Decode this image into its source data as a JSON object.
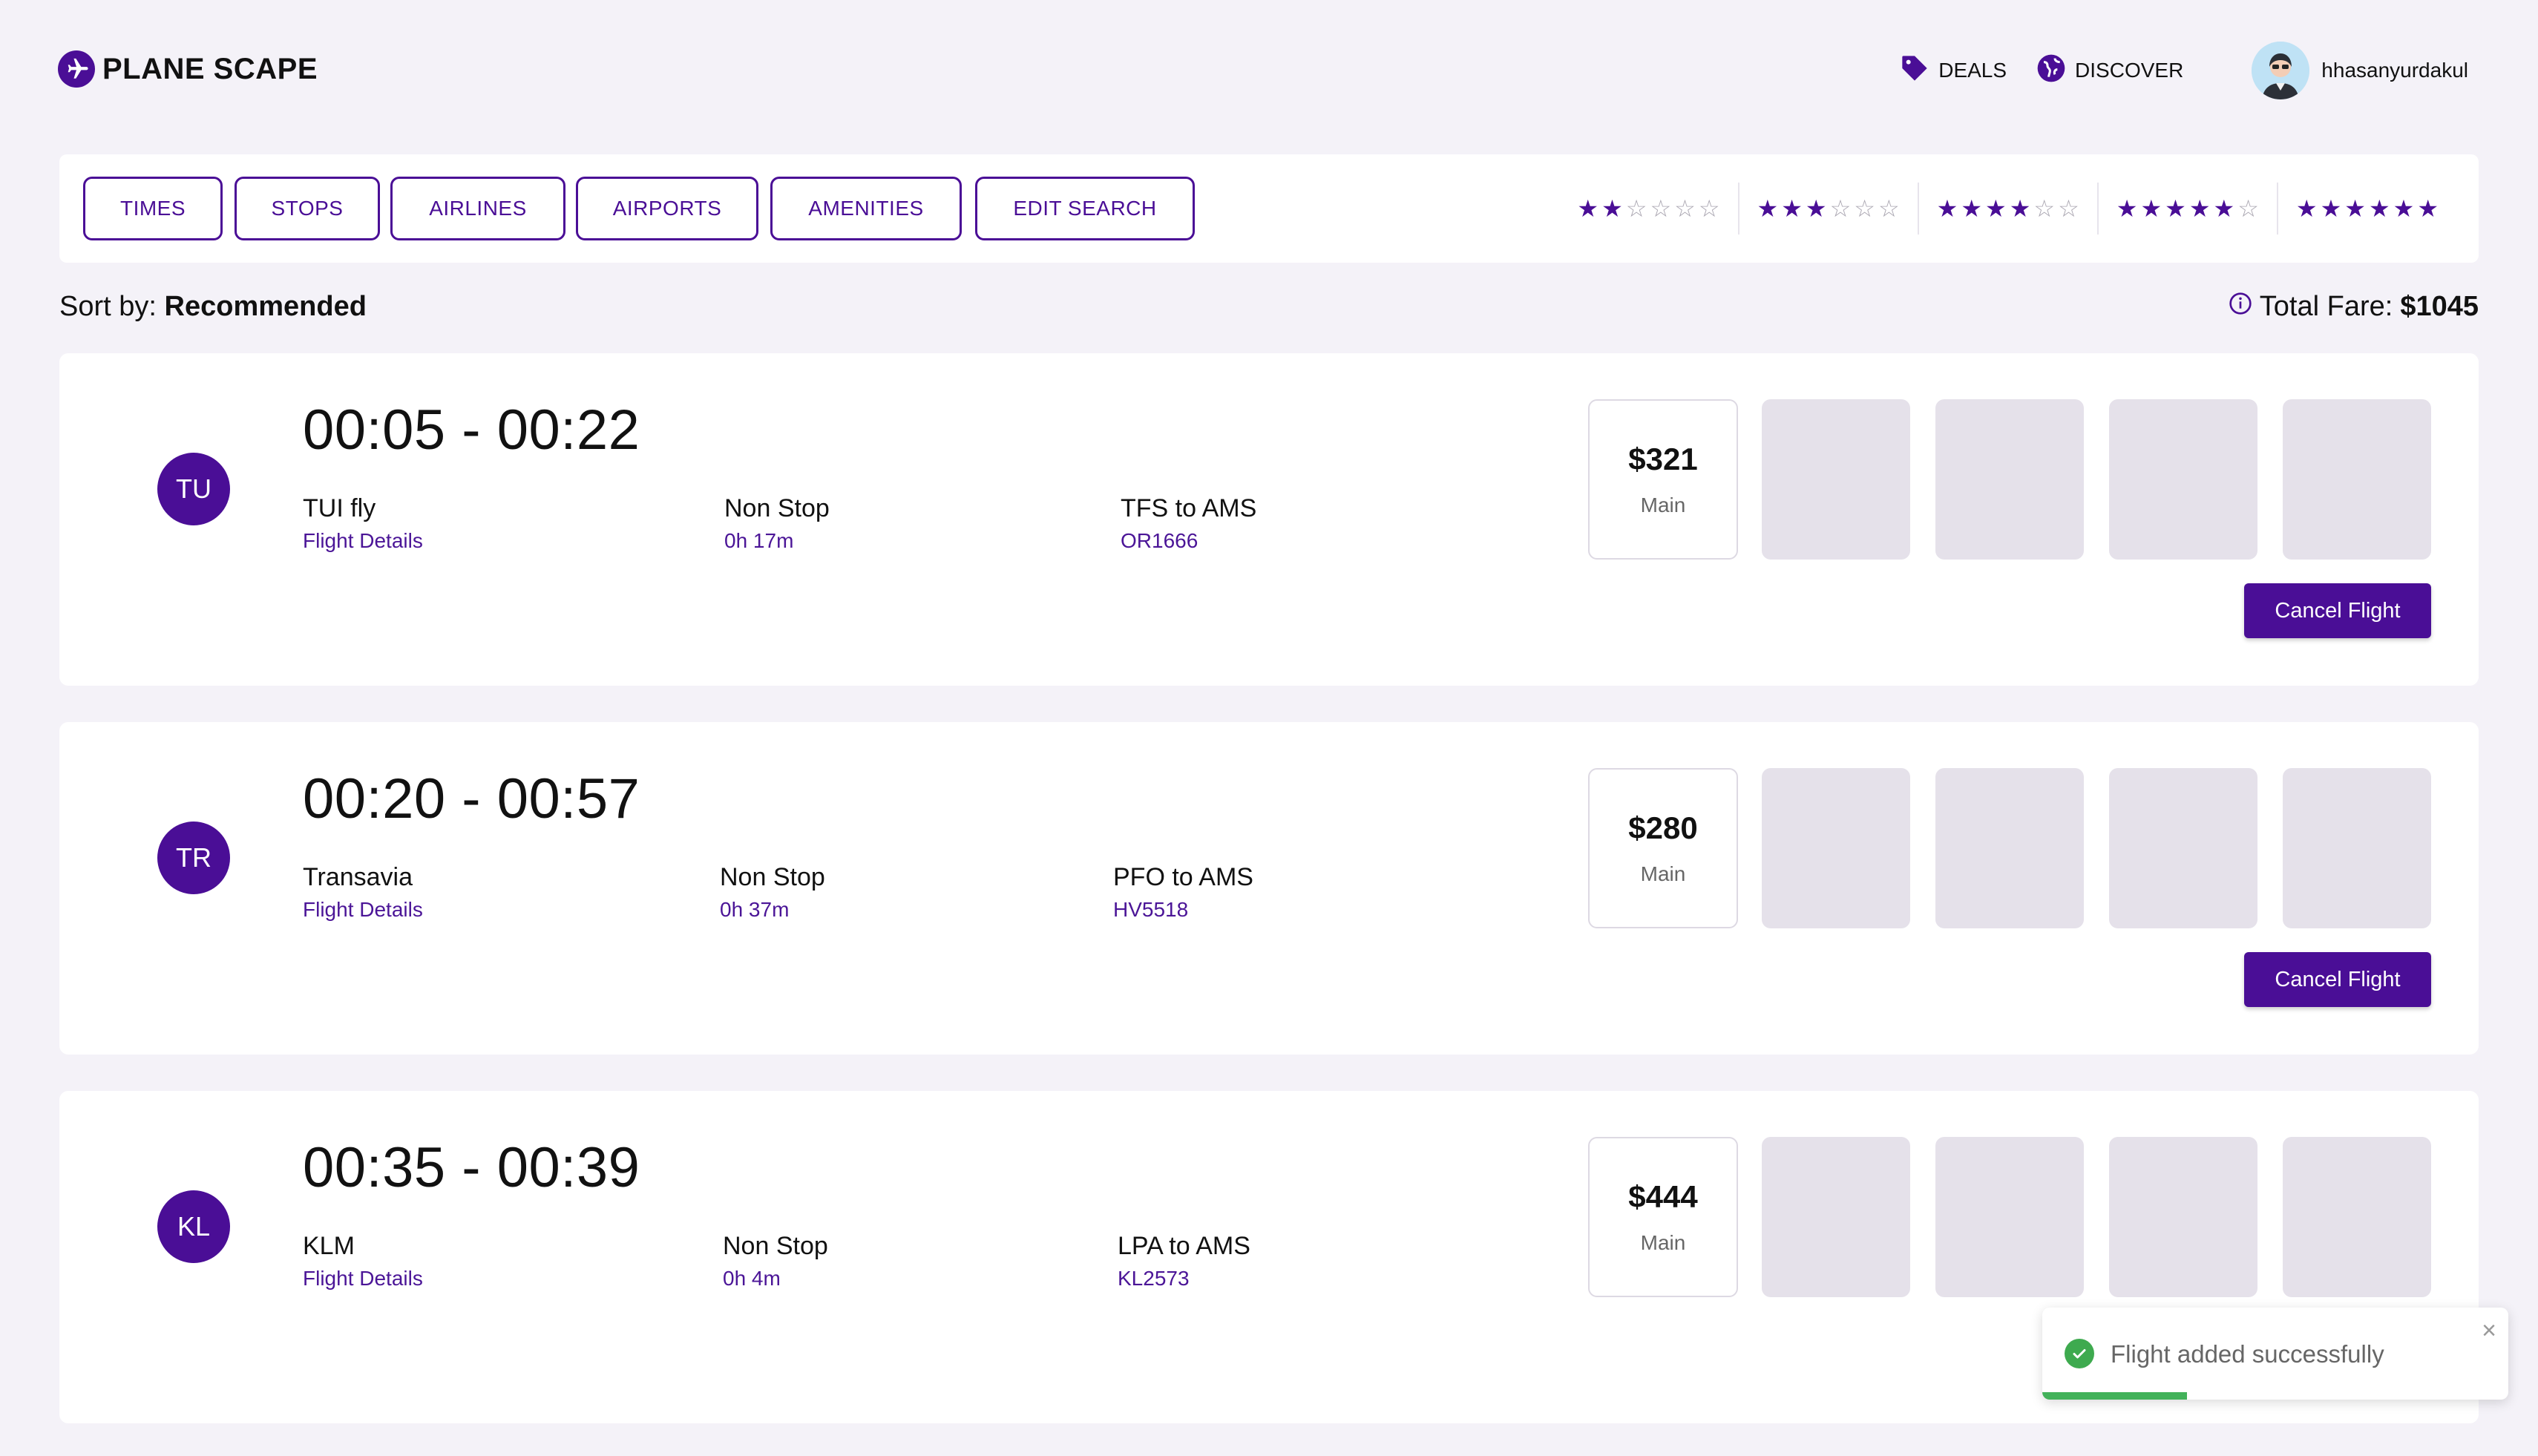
{
  "header": {
    "logo_text": "PLANE SCAPE",
    "nav": {
      "deals": "DEALS",
      "discover": "DISCOVER"
    },
    "username": "hhasanyurdakul"
  },
  "filters": {
    "buttons": [
      "TIMES",
      "STOPS",
      "AIRLINES",
      "AIRPORTS",
      "AMENITIES",
      "EDIT SEARCH"
    ],
    "star_ratings": [
      2,
      3,
      4,
      5,
      6
    ]
  },
  "sort": {
    "label": "Sort by:",
    "value": "Recommended"
  },
  "fare": {
    "label": "Total Fare:",
    "value": "$1045"
  },
  "flights": [
    {
      "initials": "TU",
      "times": "00:05 - 00:22",
      "airline": "TUI fly",
      "details_link": "Flight Details",
      "stops": "Non Stop",
      "duration": "0h 17m",
      "route": "TFS to AMS",
      "flight_no": "OR1666",
      "price": "$321",
      "class": "Main",
      "action": "Cancel Flight"
    },
    {
      "initials": "TR",
      "times": "00:20 - 00:57",
      "airline": "Transavia",
      "details_link": "Flight Details",
      "stops": "Non Stop",
      "duration": "0h 37m",
      "route": "PFO to AMS",
      "flight_no": "HV5518",
      "price": "$280",
      "class": "Main",
      "action": "Cancel Flight"
    },
    {
      "initials": "KL",
      "times": "00:35 - 00:39",
      "airline": "KLM",
      "details_link": "Flight Details",
      "stops": "Non Stop",
      "duration": "0h 4m",
      "route": "LPA to AMS",
      "flight_no": "KL2573",
      "price": "$444",
      "class": "Main"
    }
  ],
  "toast": {
    "message": "Flight added successfully",
    "close": "×",
    "progress": 0.31
  },
  "colors": {
    "accent": "#4a0e96",
    "background": "#f4f2f8",
    "success": "#3eaa4f"
  },
  "icons": [
    "plane-logo-icon",
    "tag-icon",
    "globe-icon",
    "user-avatar",
    "info-icon",
    "check-circle-icon",
    "close-icon"
  ]
}
